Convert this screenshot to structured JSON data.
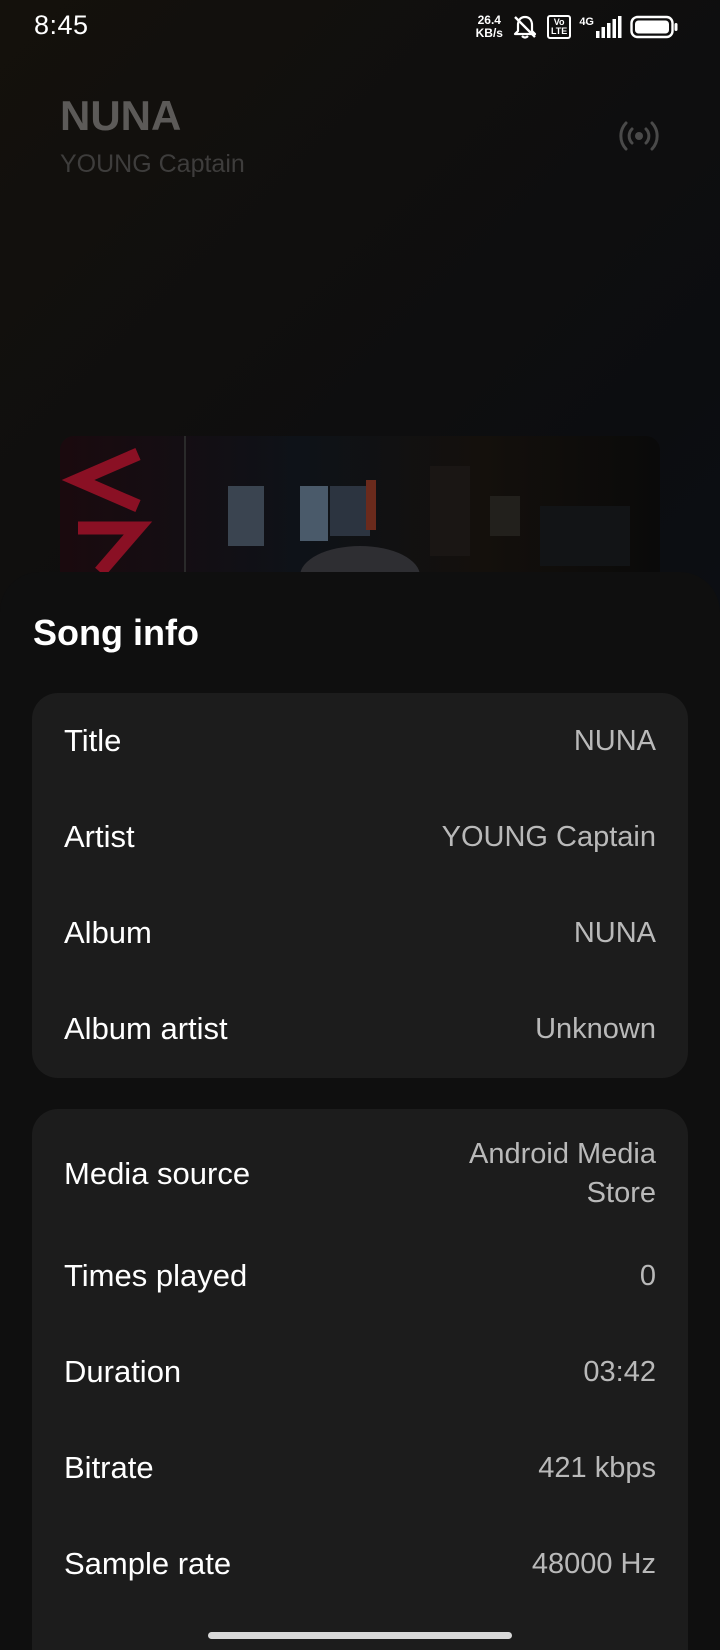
{
  "status_bar": {
    "time": "8:45",
    "net_speed_value": "26.4",
    "net_speed_unit": "KB/s",
    "volte_top": "Vo",
    "volte_bottom": "LTE",
    "network_type": "4G",
    "icons": [
      "bell-off-icon",
      "volte-icon",
      "signal-icon",
      "battery-icon"
    ]
  },
  "now_playing": {
    "title": "NUNA",
    "artist": "YOUNG Captain",
    "cast_icon": "cast-broadcast-icon"
  },
  "song_info": {
    "heading": "Song info",
    "general": [
      {
        "label": "Title",
        "value": "NUNA"
      },
      {
        "label": "Artist",
        "value": "YOUNG Captain"
      },
      {
        "label": "Album",
        "value": "NUNA"
      },
      {
        "label": "Album artist",
        "value": "Unknown"
      }
    ],
    "technical": [
      {
        "label": "Media source",
        "value_line1": "Android Media",
        "value_line2": "Store"
      },
      {
        "label": "Times played",
        "value": "0"
      },
      {
        "label": "Duration",
        "value": "03:42"
      },
      {
        "label": "Bitrate",
        "value": "421 kbps"
      },
      {
        "label": "Sample rate",
        "value": "48000 Hz"
      }
    ]
  },
  "colors": {
    "sheet_background": "#0f0f0f",
    "card_background": "#1c1c1c",
    "label_text": "#ffffff",
    "value_text": "#b9b9b9",
    "album_art_accent": "#8a1024"
  }
}
